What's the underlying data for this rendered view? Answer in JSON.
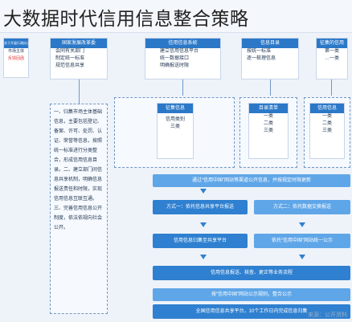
{
  "title": "大数据时代信用信息整合策略",
  "col1": {
    "header": "关于开展行政执法...",
    "lines": [
      "市场主体",
      "反馈回函"
    ]
  },
  "col2": {
    "header": "国家发展改革委",
    "lines": [
      "会同有关部门",
      "制定统一标准",
      "规范信息共享"
    ]
  },
  "col3": {
    "header": "信用信息系统",
    "lines": [
      "建立信用信息平台",
      "统一数据接口",
      "明确报送时限"
    ]
  },
  "col4": {
    "header": "信息目录",
    "lines": [
      "按统一标准",
      "逐一梳理信息"
    ]
  },
  "col5": {
    "header": "征集的信用",
    "lines": [
      "第一类",
      "…一类"
    ]
  },
  "boxA": {
    "header": "征集信息",
    "items": [
      "信用类别",
      "三类"
    ]
  },
  "boxB": {
    "header": "目录清单",
    "items": [
      "一类",
      "二类",
      "三类"
    ]
  },
  "boxC": {
    "header": "信用信息",
    "items": [
      "一类",
      "二类",
      "三类"
    ]
  },
  "side": {
    "text": "一、归集市场主体基础信息，主要包括登记、备案、许可、处罚、认证、荣誉等信息，按照统一标准进行分类整合，形成信用信息目录。二、建立部门间信息共享机制，明确信息报送责任和时限，实现信用信息互联互通。三、完善信用信息公开制度，依法依规向社会公开。"
  },
  "steps": [
    "通过“信用中国”网站等渠道公开信息，并按规定时限更新",
    "方式一：依托信息共享平台报送",
    "方式二：依托数据交换报送",
    "信用信息归集至共享平台",
    "依托“信用中国”网站统一公示",
    "信用信息报送、核查、更正等业务流程",
    "按“信用中国”网站公示规则，整合公示",
    "全国信用信息共享平台，10个工作日内完成信息归集"
  ],
  "watermark": "来源：公开资料"
}
